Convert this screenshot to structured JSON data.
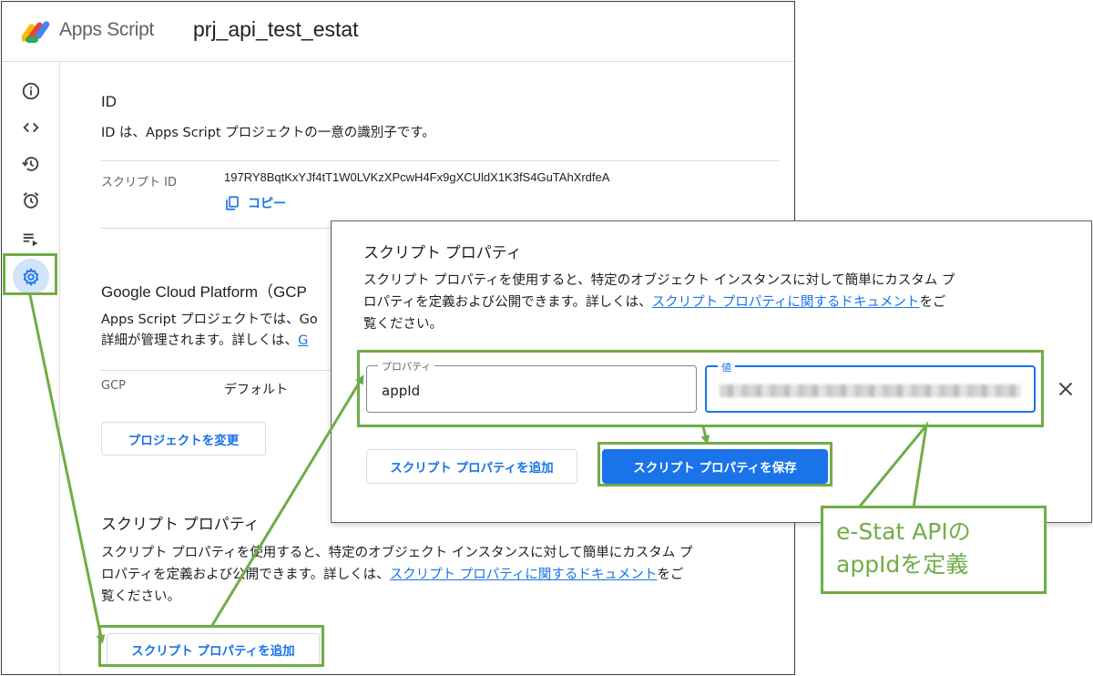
{
  "app": {
    "product_name": "Apps Script",
    "project_name": "prj_api_test_estat"
  },
  "rail": {
    "items": [
      {
        "icon": "info-icon"
      },
      {
        "icon": "code-icon"
      },
      {
        "icon": "history-icon"
      },
      {
        "icon": "alarm-icon"
      },
      {
        "icon": "executions-icon"
      },
      {
        "icon": "gear-icon",
        "active": true
      }
    ]
  },
  "id_section": {
    "title": "ID",
    "description": "ID は、Apps Script プロジェクトの一意の識別子です。",
    "script_id_label": "スクリプト ID",
    "script_id_value": "197RY8BqtKxYJf4tT1W0LVKzXPcwH4Fx9gXCUldX1K3fS4GuTAhXrdfeA",
    "copy_label": "コピー"
  },
  "gcp_section": {
    "title": "Google Cloud Platform（GCP",
    "description_line1": "Apps Script プロジェクトでは、Go",
    "description_line2": "詳細が管理されます。詳しくは、",
    "description_link": "G",
    "gcp_label": "GCP",
    "gcp_value": "デフォルト",
    "change_button": "プロジェクトを変更"
  },
  "script_props_section": {
    "title": "スクリプト プロパティ",
    "description_line1": "スクリプト プロパティを使用すると、特定のオブジェクト インスタンスに対して簡単にカスタム プ",
    "description_line2_pre": "ロパティを定義および公開できます。詳しくは、",
    "description_link": "スクリプト プロパティに関するドキュメント",
    "description_line2_post": "をご",
    "description_line3": "覧ください。",
    "add_button": "スクリプト プロパティを追加"
  },
  "dialog": {
    "title": "スクリプト プロパティ",
    "description_line1": "スクリプト プロパティを使用すると、特定のオブジェクト インスタンスに対して簡単にカスタム プ",
    "description_line2_pre": "ロパティを定義および公開できます。詳しくは、",
    "description_link": "スクリプト プロパティに関するドキュメント",
    "description_line2_post": "をご",
    "description_line3": "覧ください。",
    "property_label": "プロパティ",
    "property_value": "appId",
    "value_label": "値",
    "add_button": "スクリプト プロパティを追加",
    "save_button": "スクリプト プロパティを保存"
  },
  "annotation": {
    "callout_line1": "e-Stat APIの",
    "callout_line2": "appIdを定義",
    "color": "#70ad47"
  },
  "colors": {
    "accent": "#1a73e8",
    "active_bg": "#d2e3fc"
  }
}
